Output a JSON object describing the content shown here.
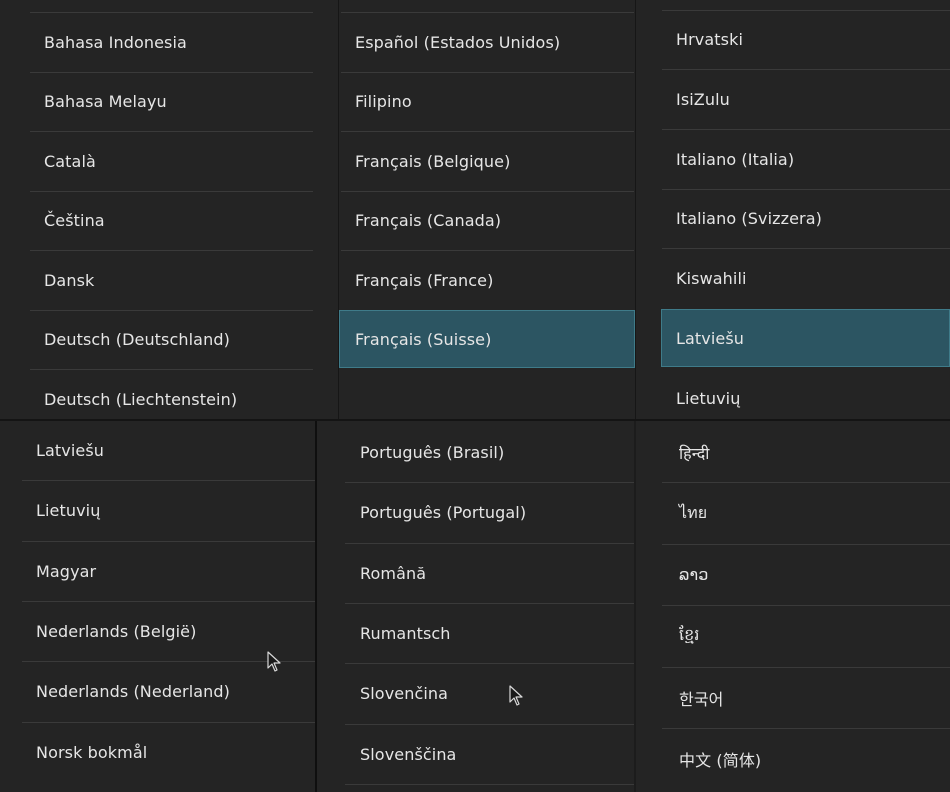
{
  "panels": [
    {
      "items": [
        "Bahasa Indonesia",
        "Bahasa Melayu",
        "Català",
        "Čeština",
        "Dansk",
        "Deutsch (Deutschland)",
        "Deutsch (Liechtenstein)"
      ],
      "selected_index": -1
    },
    {
      "items": [
        "Español (Estados Unidos)",
        "Filipino",
        "Français (Belgique)",
        "Français (Canada)",
        "Français (France)",
        "Français (Suisse)"
      ],
      "selected_index": 5
    },
    {
      "items": [
        "Hrvatski",
        "IsiZulu",
        "Italiano (Italia)",
        "Italiano (Svizzera)",
        "Kiswahili",
        "Latviešu",
        "Lietuvių"
      ],
      "selected_index": 5
    },
    {
      "items": [
        "Latviešu",
        "Lietuvių",
        "Magyar",
        "Nederlands (België)",
        "Nederlands (Nederland)",
        "Norsk bokmål"
      ],
      "selected_index": -1
    },
    {
      "items": [
        "Português (Brasil)",
        "Português (Portugal)",
        "Română",
        "Rumantsch",
        "Slovenčina",
        "Slovenščina"
      ],
      "selected_index": -1
    },
    {
      "items": [
        "हिन्दी",
        "ไทย",
        "ລາວ",
        "ខ្មែរ",
        "한국어",
        "中文 (简体)"
      ],
      "selected_index": -1
    }
  ],
  "colors": {
    "background": "#242424",
    "divider": "#3a3a3a",
    "text": "#e6e6e6",
    "selected_background": "#2c5562",
    "selected_border": "#3f7b89"
  },
  "icons": {
    "pointer": "mouse-pointer-icon"
  }
}
